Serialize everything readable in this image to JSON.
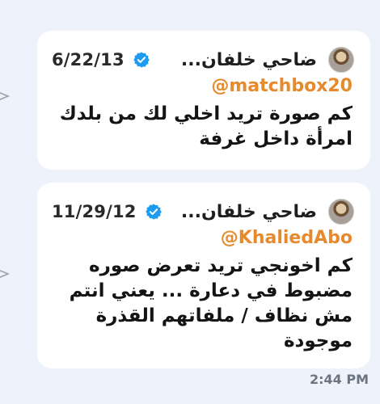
{
  "messages": [
    {
      "date": "6/22/13",
      "author": "ضاحي خلفان...",
      "mention": "@matchbox20",
      "lines": [
        "كم صورة تريد اخلي لك من بلدك",
        "امرأة داخل غرفة"
      ]
    },
    {
      "date": "11/29/12",
      "author": "ضاحي خلفان...",
      "mention": "@KhaliedAbo",
      "lines": [
        "كم اخونجي تريد تعرض صوره",
        "مضبوط في دعارة ... يعني انتم",
        "مش نظاف / ملفاتهم القذرة",
        "موجودة"
      ]
    }
  ],
  "timestamp": "2:44 PM",
  "colors": {
    "mention": "#e68a2e",
    "verified": "#1d9bf0",
    "background": "#eef3fb"
  },
  "icons": {
    "verified": "verified-badge-icon",
    "share": "share-arrow-icon"
  }
}
